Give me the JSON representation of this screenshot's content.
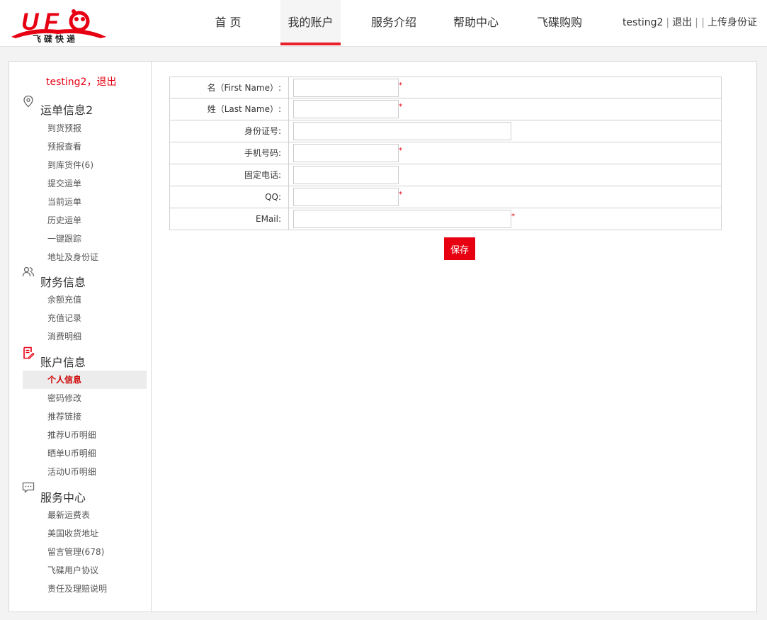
{
  "header": {
    "logo_text": "飞碟快递",
    "nav": [
      {
        "label": "首 页"
      },
      {
        "label": "我的账户"
      },
      {
        "label": "服务介绍"
      },
      {
        "label": "帮助中心"
      },
      {
        "label": "飞碟购购"
      }
    ],
    "user": {
      "username": "testing2",
      "sep1": "|",
      "logout": "退出",
      "sep2": "| |",
      "upload_id": "上传身份证"
    }
  },
  "sidebar": {
    "greeting": "testing2，退出",
    "sections": [
      {
        "title": "运单信息2",
        "items": [
          "到货预报",
          "预报查看",
          "到库货件(6)",
          "提交运单",
          "当前运单",
          "历史运单",
          "一键跟踪",
          "地址及身份证"
        ]
      },
      {
        "title": "财务信息",
        "items": [
          "余额充值",
          "充值记录",
          "消费明细"
        ]
      },
      {
        "title": "账户信息",
        "items": [
          "个人信息",
          "密码修改",
          "推荐链接",
          "推荐U币明细",
          "晒单U币明细",
          "活动U币明细"
        ]
      },
      {
        "title": "服务中心",
        "items": [
          "最新运费表",
          "美国收货地址",
          "留言管理(678)",
          "飞碟用户协议",
          "责任及理赔说明"
        ]
      }
    ]
  },
  "form": {
    "fields": [
      {
        "label": "名（First Name）:",
        "value": "",
        "required": "*"
      },
      {
        "label": "姓（Last Name）:",
        "value": "",
        "required": "*"
      },
      {
        "label": "身份证号:",
        "value": "",
        "required": ""
      },
      {
        "label": "手机号码:",
        "value": "",
        "required": "*"
      },
      {
        "label": "固定电话:",
        "value": "",
        "required": ""
      },
      {
        "label": "QQ:",
        "value": "",
        "required": "*"
      },
      {
        "label": "EMail:",
        "value": "",
        "required": "*"
      }
    ],
    "save_label": "保存"
  },
  "colors": {
    "accent": "#e60012",
    "nav_active_border": "#e8202a"
  }
}
